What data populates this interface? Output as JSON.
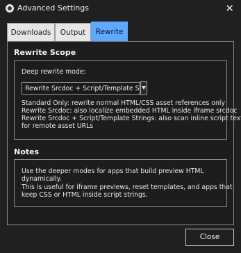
{
  "window": {
    "title": "Advanced Settings",
    "close_glyph": "✕"
  },
  "tabs": [
    {
      "label": "Downloads",
      "active": false
    },
    {
      "label": "Output",
      "active": false
    },
    {
      "label": "Rewrite",
      "active": true
    }
  ],
  "rewrite_scope": {
    "heading": "Rewrite Scope",
    "mode_label": "Deep rewrite mode:",
    "selected_mode": "Rewrite Srcdoc + Script/Template Strings",
    "description_lines": [
      "Standard Only: rewrite normal HTML/CSS asset references only",
      "Rewrite Srcdoc: also localize embedded HTML inside iframe srcdoc",
      "Rewrite Srcdoc + Script/Template Strings: also scan inline script text",
      "for remote asset URLs"
    ]
  },
  "notes": {
    "heading": "Notes",
    "lines": [
      "Use the deeper modes for apps that build preview HTML",
      "dynamically.",
      "This is useful for iframe previews, reset templates, and apps that",
      "keep CSS or HTML inside script strings."
    ]
  },
  "footer": {
    "close_label": "Close"
  },
  "colors": {
    "active_tab": "#5fa8ff",
    "background": "#202020",
    "border": "#8a8a8a"
  }
}
